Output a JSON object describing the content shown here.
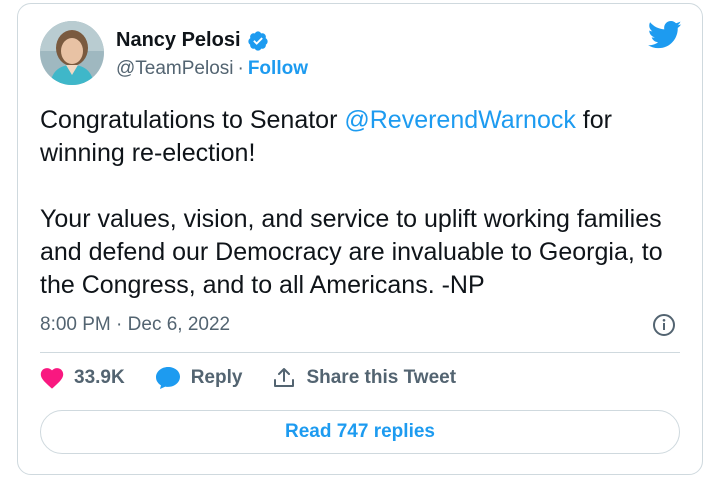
{
  "author": {
    "name": "Nancy Pelosi",
    "handle": "@TeamPelosi",
    "separator": "·",
    "follow_label": "Follow"
  },
  "tweet": {
    "line1_pre": "Congratulations to Senator ",
    "mention": "@ReverendWarnock",
    "line1_post": " for winning re-election!",
    "paragraph2": "Your values, vision, and service to uplift working families and defend our Democracy are invaluable to Georgia, to the Congress, and to all Americans. -NP"
  },
  "meta": {
    "time": "8:00 PM",
    "separator": "·",
    "date": "Dec 6, 2022"
  },
  "actions": {
    "likes": "33.9K",
    "reply_label": "Reply",
    "share_label": "Share this Tweet"
  },
  "read_replies_label": "Read 747 replies",
  "colors": {
    "accent": "#1d9bf0",
    "like": "#f91880",
    "text": "#0f1419",
    "muted": "#536471",
    "border": "#cfd9de"
  },
  "icons": [
    "verified-badge-icon",
    "twitter-bird-icon",
    "info-icon",
    "heart-icon",
    "reply-bubble-icon",
    "share-icon"
  ]
}
